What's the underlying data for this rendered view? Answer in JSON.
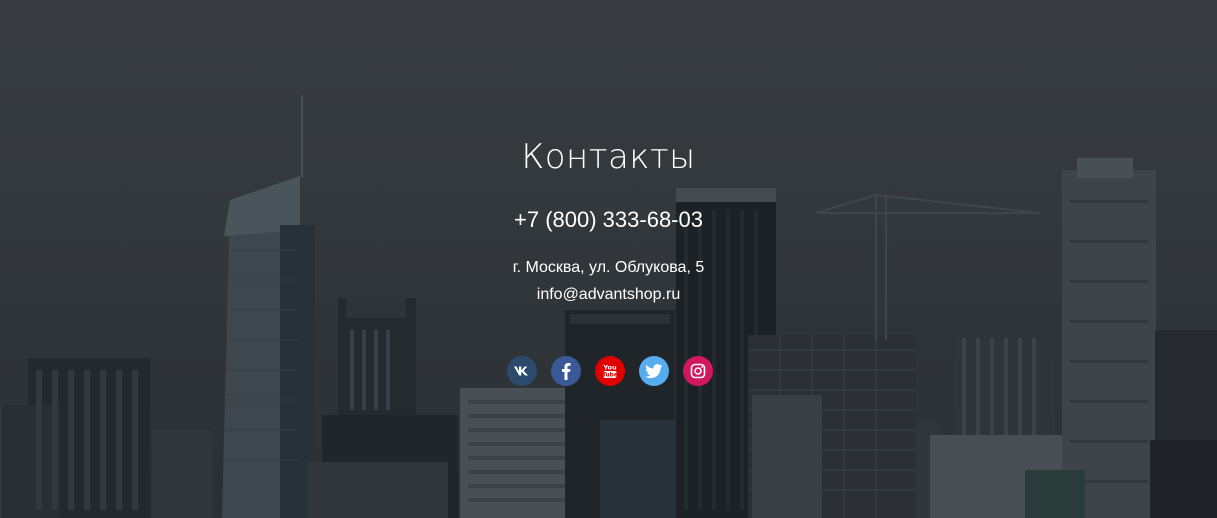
{
  "contacts": {
    "title": "Контакты",
    "phone": "+7 (800) 333-68-03",
    "address": "г. Москва, ул. Облукова, 5",
    "email": "info@advantshop.ru"
  },
  "social": [
    {
      "name": "vk",
      "icon": "vk-icon",
      "color": "#2b4a6e"
    },
    {
      "name": "facebook",
      "icon": "facebook-icon",
      "color": "#3b5998"
    },
    {
      "name": "youtube",
      "icon": "youtube-icon",
      "color": "#e00000"
    },
    {
      "name": "twitter",
      "icon": "twitter-icon",
      "color": "#55acee"
    },
    {
      "name": "instagram",
      "icon": "instagram-icon",
      "color": "#d1185f"
    }
  ],
  "background": {
    "overlay_color": "#2f3438",
    "description_icon": "city-skyline-background"
  }
}
